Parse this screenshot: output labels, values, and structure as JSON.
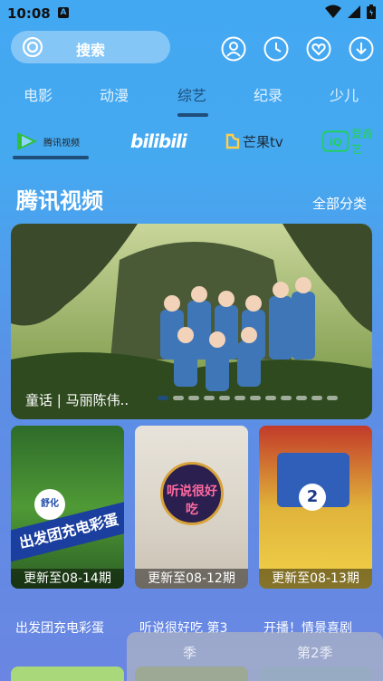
{
  "status": {
    "time": "10:08",
    "badge": "A"
  },
  "search": {
    "label": "搜索"
  },
  "top_icons": [
    "user-icon",
    "history-icon",
    "favorite-icon",
    "download-icon"
  ],
  "categories": [
    "电影",
    "动漫",
    "综艺",
    "纪录",
    "少儿"
  ],
  "active_category": "综艺",
  "platforms": [
    {
      "name": "腾讯视频",
      "selected": true
    },
    {
      "name": "bilibili",
      "selected": false
    },
    {
      "name": "芒果tv",
      "selected": false
    },
    {
      "name": "爱奇艺",
      "selected": false
    }
  ],
  "section": {
    "title": "腾讯视频",
    "more": "全部分类"
  },
  "banner": {
    "caption": "童话 | 马丽陈伟.."
  },
  "cards": [
    {
      "update": "更新至08-14期",
      "title": "出发团充电彩蛋",
      "poster_text": "出发团充电彩蛋",
      "poster_badge": "舒化"
    },
    {
      "update": "更新至08-12期",
      "title": "听说很好吃 第3",
      "poster_text": "听说很好吃"
    },
    {
      "update": "更新至08-13期",
      "title": "开播！情景喜剧"
    }
  ],
  "season_tabs": [
    "季",
    "第2季"
  ],
  "colors": {
    "accent": "#1f4e7a",
    "background_top": "#43a8f2",
    "background_bottom": "#6a86e2"
  }
}
